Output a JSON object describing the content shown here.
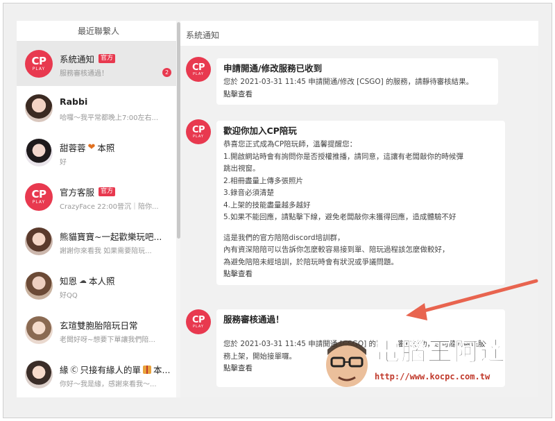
{
  "sidebar": {
    "header": "最近聯繫人",
    "contacts": [
      {
        "name": "系統通知",
        "official": "官方",
        "preview": "服務審核通過！",
        "badge": "2",
        "avatar_type": "cp"
      },
      {
        "name": "Rabbi",
        "preview": "哈囉～我平常都晚上7:00左右...",
        "avatar_type": "photo"
      },
      {
        "name": "甜蓉蓉",
        "suffix": "本照",
        "preview": "好",
        "avatar_type": "photo"
      },
      {
        "name": "官方客服",
        "official": "官方",
        "preview": "CrazyFace 22:00晉沉｜陪你...",
        "avatar_type": "cp"
      },
      {
        "name": "熊貓寶寶~一起歡樂玩吧...",
        "preview": "謝謝你來看我 如果需要陪玩...",
        "avatar_type": "photo"
      },
      {
        "name": "知恩",
        "suffix": "本人照",
        "preview": "好QQ",
        "avatar_type": "photo"
      },
      {
        "name": "玄瑄雙胞胎陪玩日常",
        "preview": "老闆好呀~想要下單讓我們陪...",
        "avatar_type": "photo"
      },
      {
        "name": "緣",
        "suffix": "只接有緣人的單",
        "suffix2": "本...",
        "preview": "你好～我是緣，感謝來看我～...",
        "avatar_type": "photo"
      }
    ],
    "logo_text": "CP",
    "logo_sub": "PLAY"
  },
  "main": {
    "header": "系統通知",
    "messages": [
      {
        "title": "申請開通/修改服務已收到",
        "lines": [
          "您於 2021-03-31 11:45 申請開通/修改 [CSGO] 的服務，請靜待審核結果。"
        ],
        "link": "點擊查看"
      },
      {
        "title": "歡迎你加入CP陪玩",
        "lines": [
          "恭喜您正式成為CP陪玩師，溫馨提醒您：",
          "1.開啟網站時會有詢問你是否授權推播，請同意，這讓有老闆敲你的時候彈",
          "跳出視窗。",
          "2.相冊盡量上傳多張照片",
          "3.錄音必須清楚",
          "4.上架的技能盡量越多越好",
          "5.如果不能回應，請點擊下線，避免老闆敲你未獲得回應，造成體驗不好"
        ],
        "lines2": [
          "這是我們的官方陪陪discord培訓群，",
          "內有資深陪陪可以告訴你怎麼較容易接到單、陪玩過程該怎麼做較好，",
          "為避免陪陪未經培訓，於陪玩時會有狀況或爭議問題。"
        ],
        "link": "點擊查看"
      },
      {
        "title": "服務審核通過！",
        "lines": [
          "您於 2021-03-31 11:45 申請開通 [CSGO] 的服務，審核成功，您可隨時處理服",
          "務上架，開始接單囉。"
        ],
        "link": "點擊查看"
      }
    ]
  },
  "watermark": {
    "title": "電腦王阿達",
    "url": "http://www.kocpc.com.tw"
  },
  "colors": {
    "brand": "#e8394f",
    "arrow": "#e8644f"
  }
}
